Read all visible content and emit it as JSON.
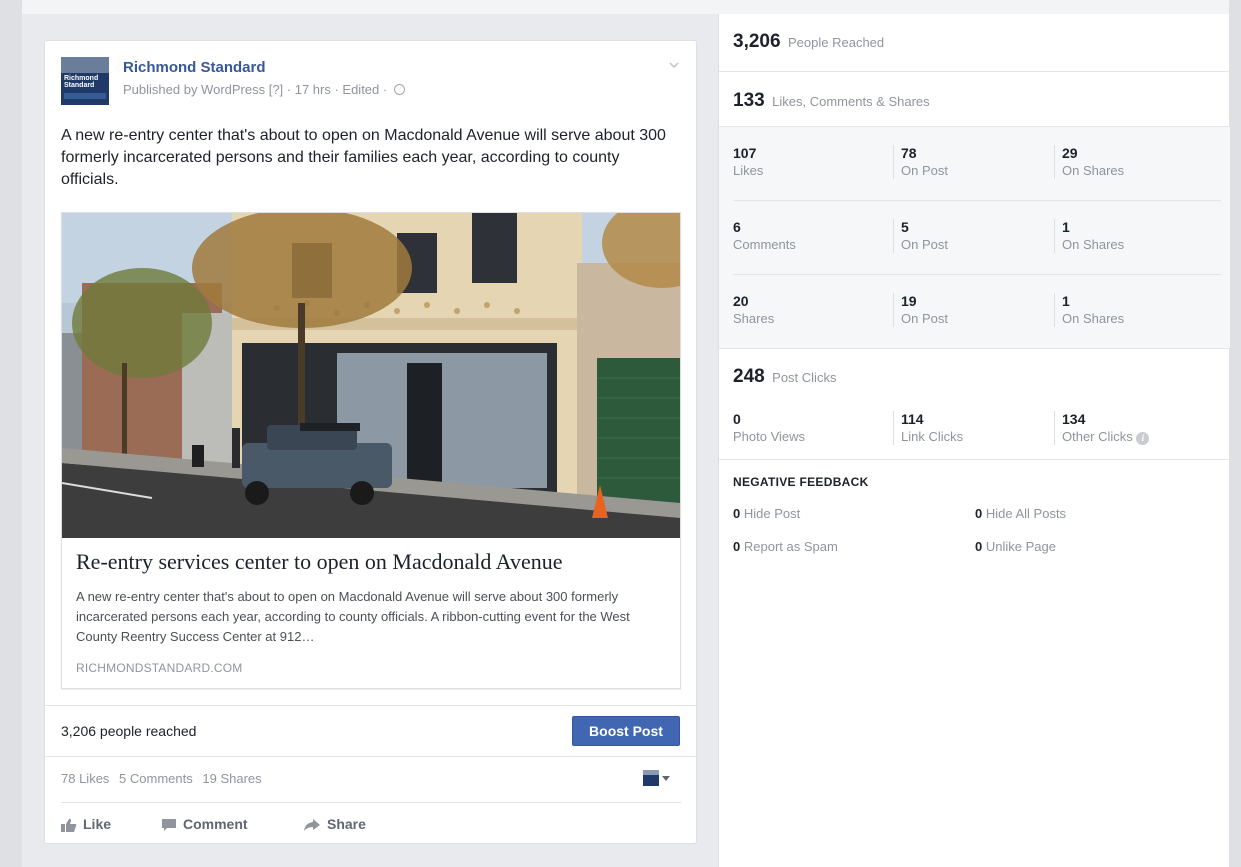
{
  "post": {
    "page_name": "Richmond Standard",
    "avatar_text": "Richmond Standard",
    "published_by": "Published by WordPress [?] · 17 hrs · Edited ·",
    "text": "A new re-entry center that's about to open on Macdonald Avenue will serve about 300 formerly incarcerated persons and their families each year, according to county officials.",
    "link": {
      "title": "Re-entry services center to open on Macdonald Avenue",
      "description": "A new re-entry center that's about to open on Macdonald Avenue will serve about 300 formerly incarcerated persons each year, according to county officials. A ribbon-cutting event for the West County Reentry Success Center at 912…",
      "domain": "RICHMONDSTANDARD.COM"
    },
    "reach_text": "3,206 people reached",
    "boost_label": "Boost Post",
    "counts": {
      "likes": "78 Likes",
      "comments": "5 Comments",
      "shares": "19 Shares"
    },
    "actions": {
      "like": "Like",
      "comment": "Comment",
      "share": "Share"
    }
  },
  "insights": {
    "people_reached": {
      "value": "3,206",
      "label": "People Reached"
    },
    "engagement": {
      "value": "133",
      "label": "Likes, Comments & Shares"
    },
    "grid": [
      [
        {
          "num": "107",
          "label": "Likes"
        },
        {
          "num": "78",
          "label": "On Post"
        },
        {
          "num": "29",
          "label": "On Shares"
        }
      ],
      [
        {
          "num": "6",
          "label": "Comments"
        },
        {
          "num": "5",
          "label": "On Post"
        },
        {
          "num": "1",
          "label": "On Shares"
        }
      ],
      [
        {
          "num": "20",
          "label": "Shares"
        },
        {
          "num": "19",
          "label": "On Post"
        },
        {
          "num": "1",
          "label": "On Shares"
        }
      ]
    ],
    "post_clicks": {
      "value": "248",
      "label": "Post Clicks"
    },
    "clicks": [
      {
        "num": "0",
        "label": "Photo Views"
      },
      {
        "num": "114",
        "label": "Link Clicks"
      },
      {
        "num": "134",
        "label": "Other Clicks"
      }
    ],
    "negative": {
      "title": "NEGATIVE FEEDBACK",
      "hide_post": {
        "num": "0",
        "label": "Hide Post"
      },
      "hide_all": {
        "num": "0",
        "label": "Hide All Posts"
      },
      "spam": {
        "num": "0",
        "label": "Report as Spam"
      },
      "unlike": {
        "num": "0",
        "label": "Unlike Page"
      }
    }
  },
  "colors": {
    "link_blue": "#365899",
    "boost_blue": "#4267b2",
    "muted": "#90949c",
    "text": "#1d2129"
  }
}
